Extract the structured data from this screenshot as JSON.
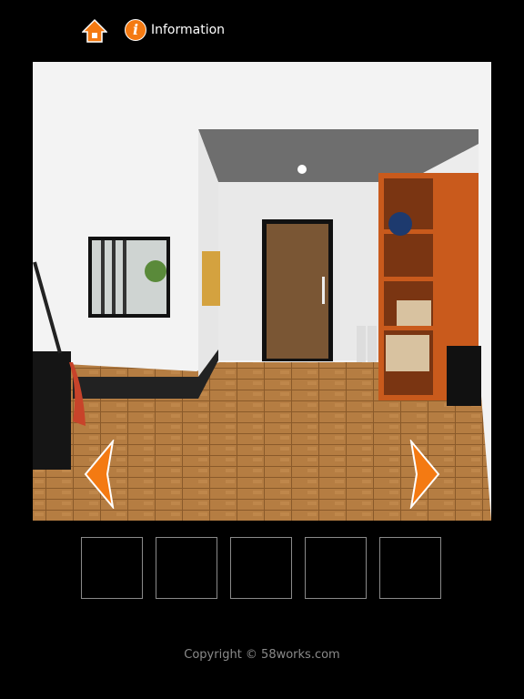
{
  "header": {
    "home_icon": "home-icon",
    "info_icon": "info-icon",
    "info_glyph": "i",
    "info_label": "Information"
  },
  "scene": {
    "nav_left": "chevron-left-icon",
    "nav_right": "chevron-right-icon",
    "accent_color": "#f47a12"
  },
  "inventory": {
    "slots": 5
  },
  "footer": {
    "copyright": "Copyright © 58works.com"
  }
}
